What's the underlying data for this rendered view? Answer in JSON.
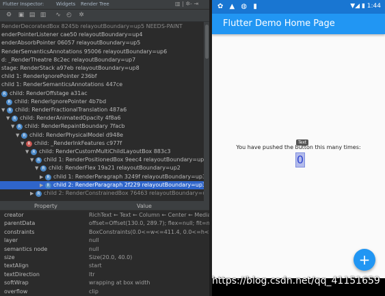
{
  "ide": {
    "tabs": [
      "Flutter Inspector:",
      "Widgets",
      "Render Tree"
    ],
    "tab_controls": "▥ | ✲- ⇥",
    "toolbar_icons": [
      "gear-icon",
      "toggle-platform-icon",
      "debug-paint-icon",
      "performance-overlay-icon",
      "repaint-rainbow-icon",
      "slow-animations-icon",
      "more-icon"
    ],
    "tree_rows": [
      {
        "indent": 0,
        "arrow": "",
        "badge": "",
        "text": "RenderDecoratedBox 8245b relayoutBoundary=up5 NEEDS-PAINT",
        "dim": true,
        "selected": false
      },
      {
        "indent": 0,
        "arrow": "",
        "badge": "",
        "text": "enderPointerListener cae50 relayoutBoundary=up4",
        "dim": false,
        "selected": false
      },
      {
        "indent": 0,
        "arrow": "",
        "badge": "",
        "text": "enderAbsorbPointer 06057 relayoutBoundary=up5",
        "dim": false,
        "selected": false
      },
      {
        "indent": 0,
        "arrow": "",
        "badge": "",
        "text": "RenderSemanticsAnnotations 95006 relayoutBoundary=up6",
        "dim": false,
        "selected": false
      },
      {
        "indent": 0,
        "arrow": "",
        "badge": "",
        "text": "d: _RenderTheatre 8c2ec relayoutBoundary=up7",
        "dim": false,
        "selected": false
      },
      {
        "indent": 0,
        "arrow": "",
        "badge": "",
        "text": "stage: RenderStack a97eb relayoutBoundary=up8",
        "dim": false,
        "selected": false
      },
      {
        "indent": 0,
        "arrow": "",
        "badge": "",
        "text": "child 1: RenderIgnorePointer 236bf",
        "dim": false,
        "selected": false
      },
      {
        "indent": 0,
        "arrow": "",
        "badge": "",
        "text": "child 1: RenderSemanticsAnnotations 447ce",
        "dim": false,
        "selected": false
      },
      {
        "indent": 0,
        "arrow": "",
        "badge": "R",
        "text": "child: RenderOffstage a31ac",
        "dim": false,
        "selected": false
      },
      {
        "indent": 1,
        "arrow": "",
        "badge": "R",
        "text": "child: RenderIgnorePointer 4b7bd",
        "dim": false,
        "selected": false
      },
      {
        "indent": 0,
        "arrow": "▼",
        "badge": "R",
        "text": "child: RenderFractionalTranslation 487a6",
        "dim": false,
        "selected": false
      },
      {
        "indent": 1,
        "arrow": "▼",
        "badge": "R",
        "text": "child: RenderAnimatedOpacity 4f8a6",
        "dim": false,
        "selected": false
      },
      {
        "indent": 2,
        "arrow": "▼",
        "badge": "R",
        "text": "child: RenderRepaintBoundary 7facb",
        "dim": false,
        "selected": false
      },
      {
        "indent": 3,
        "arrow": "▼",
        "badge": "R",
        "text": "child: RenderPhysicalModel d948e",
        "dim": false,
        "selected": false
      },
      {
        "indent": 4,
        "arrow": "▼",
        "badge": "R",
        "badge_red": true,
        "text": "child: _RenderInkFeatures c977f",
        "dim": false,
        "selected": false
      },
      {
        "indent": 5,
        "arrow": "▼",
        "badge": "R",
        "text": "child: RenderCustomMultiChildLayoutBox 883c3",
        "dim": false,
        "selected": false
      },
      {
        "indent": 6,
        "arrow": "▼",
        "badge": "R",
        "text": "child 1: RenderPositionedBox 9eec4 relayoutBoundary=up1",
        "dim": false,
        "selected": false
      },
      {
        "indent": 7,
        "arrow": "▼",
        "badge": "R",
        "text": "child: RenderFlex 19a21 relayoutBoundary=up2",
        "dim": false,
        "selected": false
      },
      {
        "indent": 8,
        "arrow": "▶",
        "badge": "R",
        "text": "child 1: RenderParagraph 3249f relayoutBoundary=up3",
        "dim": false,
        "selected": false
      },
      {
        "indent": 8,
        "arrow": "▶",
        "badge": "R",
        "text": "child 2: RenderParagraph 2f229 relayoutBoundary=up3",
        "dim": false,
        "selected": true
      },
      {
        "indent": 6,
        "arrow": "▶",
        "badge": "R",
        "text": "child 2: RenderConstrainedBox 76463 relayoutBoundary=up1",
        "dim": true,
        "selected": false
      }
    ],
    "props_header": {
      "property": "Property",
      "value": "Value"
    },
    "properties": [
      {
        "name": "creator",
        "value": "RichText ← Text ← Column ← Center ← Media"
      },
      {
        "name": "parentData",
        "value": "offset=Offset(130.0, 289.7); flex=null; fit=nu"
      },
      {
        "name": "constraints",
        "value": "BoxConstraints(0.0<=w<=411.4, 0.0<=h<="
      },
      {
        "name": "layer",
        "value": "null"
      },
      {
        "name": "semantics node",
        "value": "null"
      },
      {
        "name": "size",
        "value": "Size(20.0, 40.0)"
      },
      {
        "name": "textAlign",
        "value": "start"
      },
      {
        "name": "textDirection",
        "value": "ltr"
      },
      {
        "name": "softWrap",
        "value": "wrapping at box width"
      },
      {
        "name": "overflow",
        "value": "clip"
      }
    ]
  },
  "phone": {
    "status_left": "✿ ▲ ◍ ▮",
    "status_right": "▼◢ ▮ 1:44",
    "app_title": "Flutter Demo Home Page",
    "message": "You have pushed the button this many times:",
    "counter": "0",
    "tooltip": "Text",
    "fab_label": "+"
  },
  "watermark": "https://blog.csdn.net/qq_41151659",
  "colors": {
    "primary": "#2196f3",
    "status_bar": "#1976d2",
    "selection": "#2f65ca",
    "ide_bg": "#2b2b2b"
  }
}
